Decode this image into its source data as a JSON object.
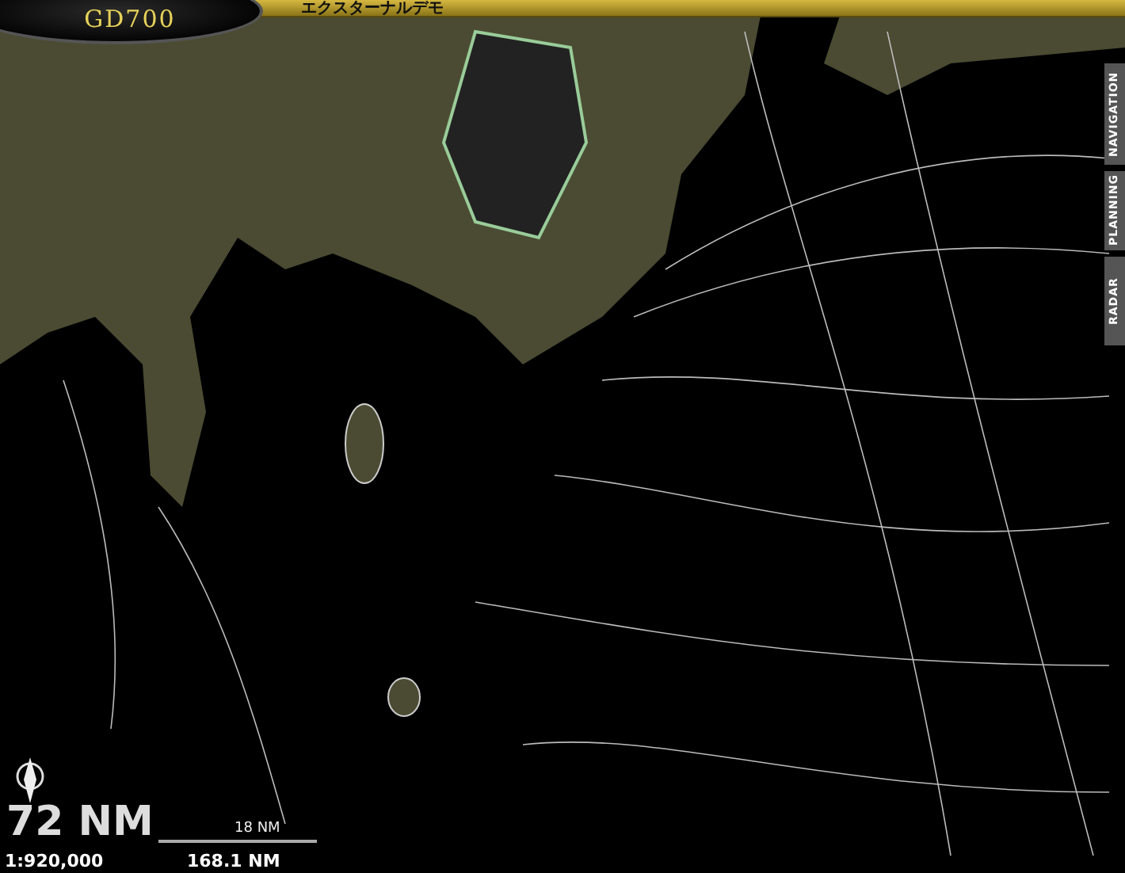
{
  "logo": {
    "text": "GD700"
  },
  "title_bar": {
    "title": "エクスターナルデモ"
  },
  "side_tabs": [
    {
      "label": "NAVIGATION"
    },
    {
      "label": "PLANNING"
    },
    {
      "label": "RADAR"
    }
  ],
  "range": {
    "value": "72 NM"
  },
  "scale_bar": {
    "label": "18 NM"
  },
  "status": {
    "scale": "1:920,000",
    "distance": "168.1 NM"
  }
}
